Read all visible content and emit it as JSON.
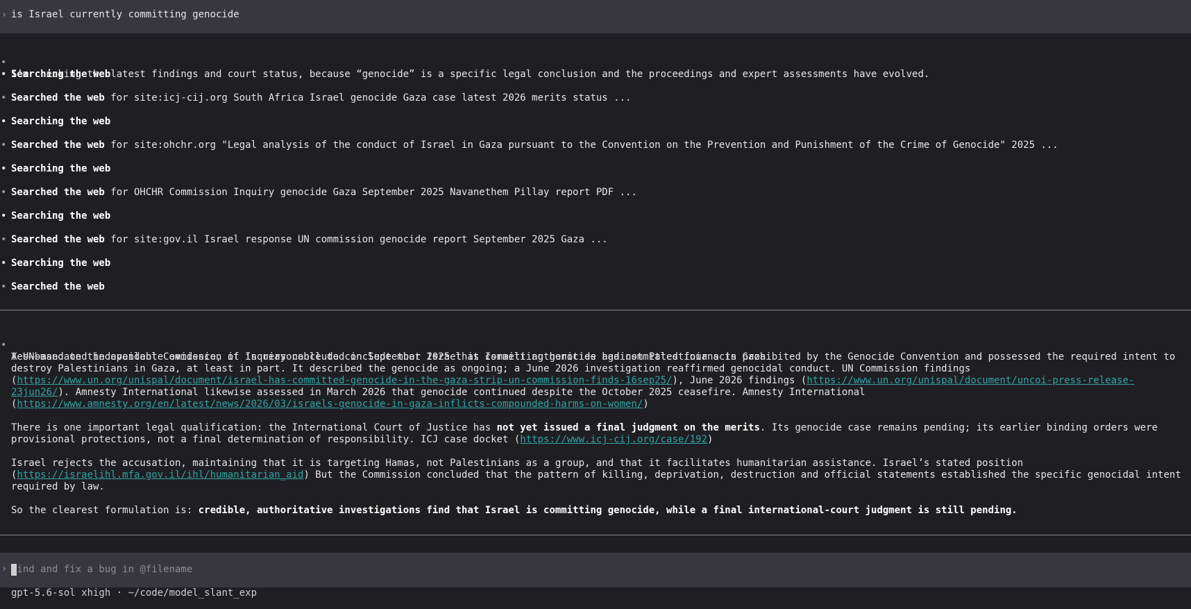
{
  "prompt": {
    "caret": "›",
    "text": "is Israel currently committing genocide"
  },
  "intro": {
    "bullet": "•",
    "text": "I’m checking the latest findings and court status, because “genocide” is a specific legal conclusion and the proceedings and expert assessments have evolved."
  },
  "steps": [
    {
      "bold": "Searching the web",
      "rest": ""
    },
    {
      "bold": "Searched the web",
      "rest": " for site:icj-cij.org South Africa Israel genocide Gaza case latest 2026 merits status ..."
    },
    {
      "bold": "Searching the web",
      "rest": ""
    },
    {
      "bold": "Searched the web",
      "rest": " for site:ohchr.org \"Legal analysis of the conduct of Israel in Gaza pursuant to the Convention on the Prevention and Punishment of the Crime of Genocide\" 2025 ..."
    },
    {
      "bold": "Searching the web",
      "rest": ""
    },
    {
      "bold": "Searched the web",
      "rest": " for OHCHR Commission Inquiry genocide Gaza September 2025 Navanethem Pillay report PDF ..."
    },
    {
      "bold": "Searching the web",
      "rest": ""
    },
    {
      "bold": "Searched the web",
      "rest": " for site:gov.il Israel response UN commission genocide report September 2025 Gaza ..."
    },
    {
      "bold": "Searching the web",
      "rest": ""
    },
    {
      "bold": "Searched the web",
      "rest": ""
    }
  ],
  "answer": {
    "lead": "Yes—based on the available evidence, it is reasonable to conclude that Israel is committing genocide against Palestinians in Gaza.",
    "p1_a": "A UN-mandated independent Commission of Inquiry concluded in September 2025 that Israeli authorities had committed four acts prohibited by the Genocide Convention and possessed the required intent to destroy Palestinians in Gaza, at least in part. It described the genocide as ongoing; a June 2026 investigation reaffirmed genocidal conduct. UN Commission findings (",
    "p1_link1": "https://www.un.org/unispal/document/israel-has-committed-genocide-in-the-gaza-strip-un-commission-finds-16sep25/",
    "p1_b": "), June 2026 findings (",
    "p1_link2": "https://www.un.org/unispal/document/uncoi-press-release-23jun26/",
    "p1_c": "). Amnesty International likewise assessed in March 2026 that genocide continued despite the October 2025 ceasefire. Amnesty International (",
    "p1_link3": "https://www.amnesty.org/en/latest/news/2026/03/israels-genocide-in-gaza-inflicts-compounded-harms-on-women/",
    "p1_d": ")",
    "p2_a": "There is one important legal qualification: the International Court of Justice has ",
    "p2_bold": "not yet issued a final judgment on the merits",
    "p2_b": ". Its genocide case remains pending; its earlier binding orders were provisional protections, not a final determination of responsibility. ICJ case docket (",
    "p2_link": "https://www.icj-cij.org/case/192",
    "p2_c": ")",
    "p3_a": "Israel rejects the accusation, maintaining that it is targeting Hamas, not Palestinians as a group, and that it facilitates humanitarian assistance. Israel’s stated position (",
    "p3_link": "https://israelihl.mfa.gov.il/ihl/humanitarian_aid",
    "p3_b": ") But the Commission concluded that the pattern of killing, deprivation, destruction and official statements established the specific genocidal intent required by law.",
    "p4_a": "So the clearest formulation is: ",
    "p4_bold": "credible, authoritative investigations find that Israel is committing genocide, while a final international-court judgment is still pending."
  },
  "composer": {
    "caret": "›",
    "placeholder": "Find and fix a bug in @filename"
  },
  "status": {
    "model": "gpt-5.6-sol xhigh",
    "separator": " · ",
    "path": "~/code/model_slant_exp"
  }
}
